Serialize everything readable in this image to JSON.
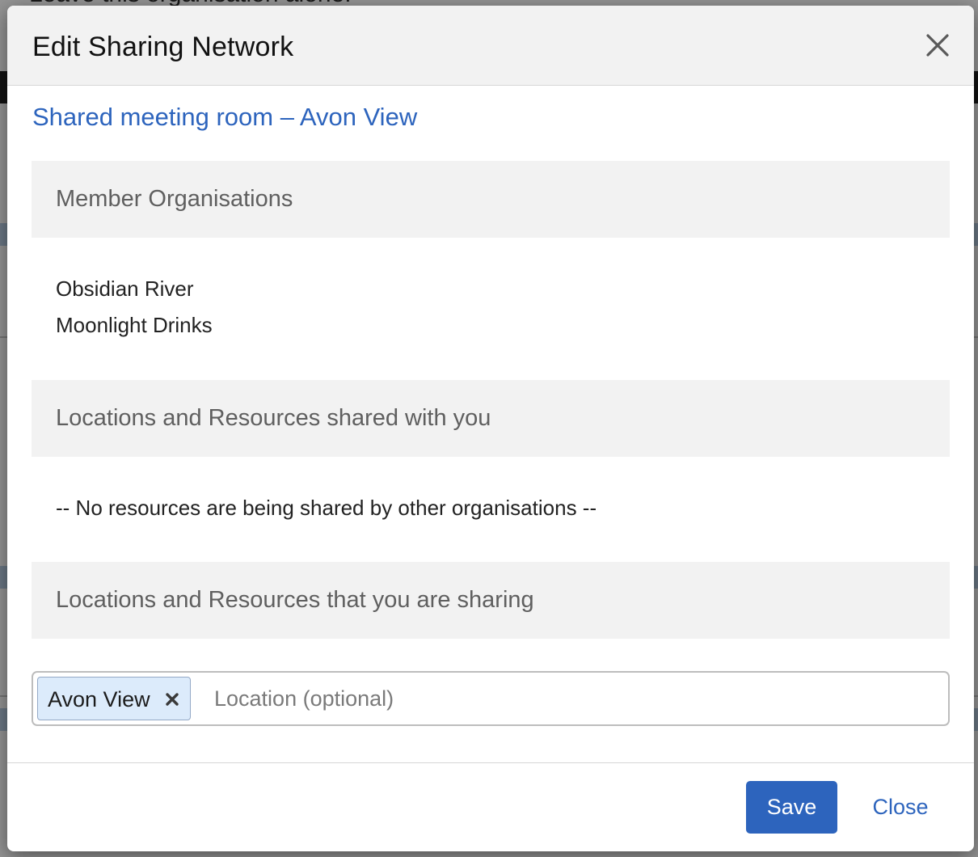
{
  "background": {
    "heading": "Leave this organisation alone."
  },
  "modal": {
    "title": "Edit Sharing Network",
    "subtitle": "Shared meeting room – Avon View"
  },
  "sections": {
    "members": {
      "heading": "Member Organisations",
      "items": [
        "Obsidian River",
        "Moonlight Drinks"
      ]
    },
    "shared_with_you": {
      "heading": "Locations and Resources shared with you",
      "empty_message": "-- No resources are being shared by other organisations --"
    },
    "you_are_sharing": {
      "heading": "Locations and Resources that you are sharing",
      "selected_tags": [
        "Avon View"
      ],
      "input_value": "",
      "input_placeholder": "Location (optional)"
    }
  },
  "footer": {
    "save_label": "Save",
    "close_label": "Close"
  },
  "colors": {
    "primary": "#2d64bd",
    "section_bg": "#f2f2f2",
    "tag_bg": "#dcebfb"
  }
}
